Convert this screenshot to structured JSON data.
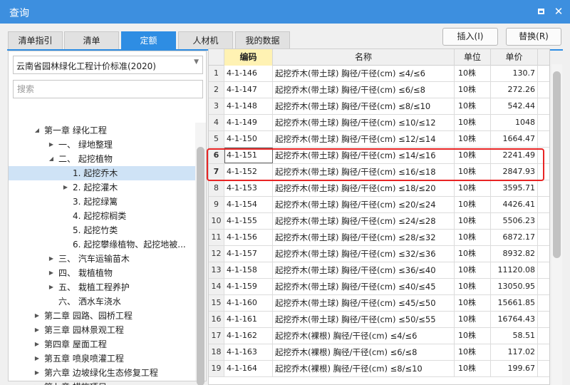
{
  "window": {
    "title": "查询",
    "restore_icon": "restore-icon",
    "close_glyph": "✕"
  },
  "tabs": [
    {
      "label": "清单指引",
      "active": false
    },
    {
      "label": "清单",
      "active": false
    },
    {
      "label": "定额",
      "active": true
    },
    {
      "label": "人材机",
      "active": false
    },
    {
      "label": "我的数据",
      "active": false
    }
  ],
  "actions": {
    "insert_label": "插入(I)",
    "replace_label": "替换(R)"
  },
  "left": {
    "standard_selected": "云南省园林绿化工程计价标准(2020)",
    "search_placeholder": "搜索",
    "tree": [
      {
        "toggle": "◢",
        "label": "第一章 绿化工程",
        "level": 0
      },
      {
        "toggle": "▶",
        "label": "一、 绿地整理",
        "level": 1
      },
      {
        "toggle": "◢",
        "label": "二、 起挖植物",
        "level": 1
      },
      {
        "toggle": "",
        "label": "1. 起挖乔木",
        "level": 2,
        "selected": true
      },
      {
        "toggle": "▶",
        "label": "2. 起挖灌木",
        "level": 2
      },
      {
        "toggle": "",
        "label": "3. 起挖绿篱",
        "level": 2
      },
      {
        "toggle": "",
        "label": "4. 起挖棕榈类",
        "level": 2
      },
      {
        "toggle": "",
        "label": "5. 起挖竹类",
        "level": 2
      },
      {
        "toggle": "",
        "label": "6. 起挖攀缘植物、起挖地被...",
        "level": 2
      },
      {
        "toggle": "▶",
        "label": "三、 汽车运输苗木",
        "level": 1
      },
      {
        "toggle": "▶",
        "label": "四、 栽植植物",
        "level": 1
      },
      {
        "toggle": "▶",
        "label": "五、 栽植工程养护",
        "level": 1
      },
      {
        "toggle": "",
        "label": "六、 洒水车浇水",
        "level": 1
      },
      {
        "toggle": "▶",
        "label": "第二章 园路、园桥工程",
        "level": 0
      },
      {
        "toggle": "▶",
        "label": "第三章 园林景观工程",
        "level": 0
      },
      {
        "toggle": "▶",
        "label": "第四章 屋面工程",
        "level": 0
      },
      {
        "toggle": "▶",
        "label": "第五章 喷泉喷灌工程",
        "level": 0
      },
      {
        "toggle": "▶",
        "label": "第六章 边坡绿化生态修复工程",
        "level": 0
      },
      {
        "toggle": "▶",
        "label": "第七章 措施项目",
        "level": 0
      }
    ]
  },
  "grid": {
    "headers": {
      "code": "编码",
      "name": "名称",
      "unit": "单位",
      "price": "单价"
    },
    "rows": [
      {
        "num": "1",
        "code": "4-1-146",
        "name": "起挖乔木(带土球) 胸径/干径(cm) ≤4/≤6",
        "unit": "10株",
        "price": "130.7"
      },
      {
        "num": "2",
        "code": "4-1-147",
        "name": "起挖乔木(带土球) 胸径/干径(cm) ≤6/≤8",
        "unit": "10株",
        "price": "272.26"
      },
      {
        "num": "3",
        "code": "4-1-148",
        "name": "起挖乔木(带土球) 胸径/干径(cm) ≤8/≤10",
        "unit": "10株",
        "price": "542.44"
      },
      {
        "num": "4",
        "code": "4-1-149",
        "name": "起挖乔木(带土球) 胸径/干径(cm) ≤10/≤12",
        "unit": "10株",
        "price": "1048"
      },
      {
        "num": "5",
        "code": "4-1-150",
        "name": "起挖乔木(带土球) 胸径/干径(cm) ≤12/≤14",
        "unit": "10株",
        "price": "1664.47"
      },
      {
        "num": "6",
        "code": "4-1-151",
        "name": "起挖乔木(带土球) 胸径/干径(cm) ≤14/≤16",
        "unit": "10株",
        "price": "2241.49",
        "highlight": true
      },
      {
        "num": "7",
        "code": "4-1-152",
        "name": "起挖乔木(带土球) 胸径/干径(cm) ≤16/≤18",
        "unit": "10株",
        "price": "2847.93",
        "highlight": true
      },
      {
        "num": "8",
        "code": "4-1-153",
        "name": "起挖乔木(带土球) 胸径/干径(cm) ≤18/≤20",
        "unit": "10株",
        "price": "3595.71"
      },
      {
        "num": "9",
        "code": "4-1-154",
        "name": "起挖乔木(带土球) 胸径/干径(cm) ≤20/≤24",
        "unit": "10株",
        "price": "4426.41"
      },
      {
        "num": "10",
        "code": "4-1-155",
        "name": "起挖乔木(带土球) 胸径/干径(cm) ≤24/≤28",
        "unit": "10株",
        "price": "5506.23"
      },
      {
        "num": "11",
        "code": "4-1-156",
        "name": "起挖乔木(带土球) 胸径/干径(cm) ≤28/≤32",
        "unit": "10株",
        "price": "6872.17"
      },
      {
        "num": "12",
        "code": "4-1-157",
        "name": "起挖乔木(带土球) 胸径/干径(cm) ≤32/≤36",
        "unit": "10株",
        "price": "8932.82"
      },
      {
        "num": "13",
        "code": "4-1-158",
        "name": "起挖乔木(带土球) 胸径/干径(cm) ≤36/≤40",
        "unit": "10株",
        "price": "11120.08"
      },
      {
        "num": "14",
        "code": "4-1-159",
        "name": "起挖乔木(带土球) 胸径/干径(cm) ≤40/≤45",
        "unit": "10株",
        "price": "13050.95"
      },
      {
        "num": "15",
        "code": "4-1-160",
        "name": "起挖乔木(带土球) 胸径/干径(cm) ≤45/≤50",
        "unit": "10株",
        "price": "15661.85"
      },
      {
        "num": "16",
        "code": "4-1-161",
        "name": "起挖乔木(带土球) 胸径/干径(cm) ≤50/≤55",
        "unit": "10株",
        "price": "16764.43"
      },
      {
        "num": "17",
        "code": "4-1-162",
        "name": "起挖乔木(裸根) 胸径/干径(cm) ≤4/≤6",
        "unit": "10株",
        "price": "58.51"
      },
      {
        "num": "18",
        "code": "4-1-163",
        "name": "起挖乔木(裸根) 胸径/干径(cm) ≤6/≤8",
        "unit": "10株",
        "price": "117.02"
      },
      {
        "num": "19",
        "code": "4-1-164",
        "name": "起挖乔木(裸根) 胸径/干径(cm) ≤8/≤10",
        "unit": "10株",
        "price": "199.67"
      }
    ]
  },
  "colors": {
    "titlebar": "#3d8fdf",
    "active_tab": "#2e8de3",
    "selection": "#cfe3f6",
    "highlight_box": "#e82424",
    "code_header": "#fff2b3"
  }
}
